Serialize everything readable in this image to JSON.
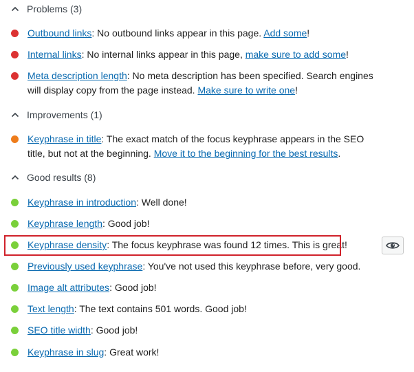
{
  "colors": {
    "problem": "#dc3232",
    "improvement": "#ee7c1b",
    "good": "#7ad03a",
    "link": "#0a6ab0",
    "highlight": "#d0212a"
  },
  "sections": {
    "problems": {
      "label": "Problems (3)",
      "items": [
        {
          "link": "Outbound links",
          "text": ": No outbound links appear in this page. ",
          "cta": "Add some",
          "end": "!"
        },
        {
          "link": "Internal links",
          "text": ": No internal links appear in this page, ",
          "cta": "make sure to add some",
          "end": "!"
        },
        {
          "link": "Meta description length",
          "text": ": No meta description has been specified. Search engines will display copy from the page instead. ",
          "cta": "Make sure to write one",
          "end": "!"
        }
      ]
    },
    "improvements": {
      "label": "Improvements (1)",
      "items": [
        {
          "link": "Keyphrase in title",
          "text": ": The exact match of the focus keyphrase appears in the SEO title, but not at the beginning. ",
          "cta": "Move it to the beginning for the best results",
          "end": "."
        }
      ]
    },
    "good": {
      "label": "Good results (8)",
      "items": [
        {
          "link": "Keyphrase in introduction",
          "text": ": Well done!"
        },
        {
          "link": "Keyphrase length",
          "text": ": Good job!"
        },
        {
          "link": "Keyphrase density",
          "text": ": The focus keyphrase was found 12 times. This is great!"
        },
        {
          "link": "Previously used keyphrase",
          "text": ": You've not used this keyphrase before, very good."
        },
        {
          "link": "Image alt attributes",
          "text": ": Good job!"
        },
        {
          "link": "Text length",
          "text": ": The text contains 501 words. Good job!"
        },
        {
          "link": "SEO title width",
          "text": ": Good job!"
        },
        {
          "link": "Keyphrase in slug",
          "text": ": Great work!"
        }
      ]
    }
  },
  "icons": {
    "section_toggle": "chevron-up-icon",
    "highlight_button": "eye-icon"
  }
}
